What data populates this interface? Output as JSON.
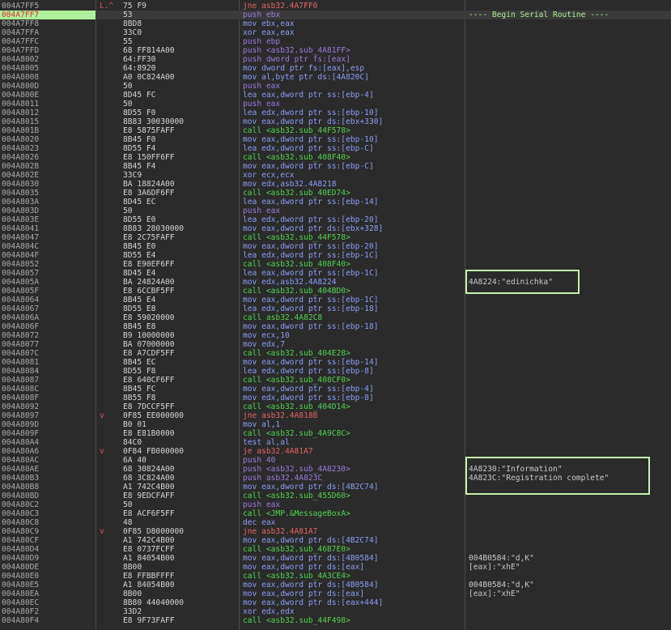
{
  "colors": {
    "background": "#2b2b2b",
    "selected_row": "#aef09a",
    "call": "#52d152",
    "jump": "#e06666",
    "push": "#9b7bd9",
    "mov": "#8c9ef2",
    "highlight_box": "#c8f0b0"
  },
  "rows": [
    {
      "addr": "004A7FF5",
      "mark": "L.^",
      "bytes": "75 F9",
      "instr": "jne asb32.4A7FF0",
      "kind": "jmp",
      "comment": ""
    },
    {
      "addr": "004A7FF7",
      "mark": "",
      "bytes": "53",
      "instr": "push ebx",
      "kind": "push",
      "comment": "---- Begin Serial Routine ----",
      "selected": true
    },
    {
      "addr": "004A7FF8",
      "mark": "",
      "bytes": "8BD8",
      "instr": "mov ebx,eax",
      "kind": "mov",
      "comment": ""
    },
    {
      "addr": "004A7FFA",
      "mark": "",
      "bytes": "33C0",
      "instr": "xor eax,eax",
      "kind": "xor",
      "comment": ""
    },
    {
      "addr": "004A7FFC",
      "mark": "",
      "bytes": "55",
      "instr": "push ebp",
      "kind": "push",
      "comment": ""
    },
    {
      "addr": "004A7FFD",
      "mark": "",
      "bytes": "68 FF814A00",
      "instr": "push <asb32.sub_4A81FF>",
      "kind": "push",
      "comment": ""
    },
    {
      "addr": "004A8002",
      "mark": "",
      "bytes": "64:FF30",
      "instr": "push dword ptr fs:[eax]",
      "kind": "push",
      "comment": ""
    },
    {
      "addr": "004A8005",
      "mark": "",
      "bytes": "64:8920",
      "instr": "mov dword ptr fs:[eax],esp",
      "kind": "mov",
      "comment": ""
    },
    {
      "addr": "004A8008",
      "mark": "",
      "bytes": "A0 0C824A00",
      "instr": "mov al,byte ptr ds:[4A820C]",
      "kind": "mov",
      "comment": ""
    },
    {
      "addr": "004A800D",
      "mark": "",
      "bytes": "50",
      "instr": "push eax",
      "kind": "push",
      "comment": ""
    },
    {
      "addr": "004A800E",
      "mark": "",
      "bytes": "8D45 FC",
      "instr": "lea eax,dword ptr ss:[ebp-4]",
      "kind": "lea",
      "comment": ""
    },
    {
      "addr": "004A8011",
      "mark": "",
      "bytes": "50",
      "instr": "push eax",
      "kind": "push",
      "comment": ""
    },
    {
      "addr": "004A8012",
      "mark": "",
      "bytes": "8D55 F0",
      "instr": "lea edx,dword ptr ss:[ebp-10]",
      "kind": "lea",
      "comment": ""
    },
    {
      "addr": "004A8015",
      "mark": "",
      "bytes": "8B83 30030000",
      "instr": "mov eax,dword ptr ds:[ebx+330]",
      "kind": "mov",
      "comment": ""
    },
    {
      "addr": "004A801B",
      "mark": "",
      "bytes": "E8 5875FAFF",
      "instr": "call <asb32.sub_44F578>",
      "kind": "call",
      "comment": ""
    },
    {
      "addr": "004A8020",
      "mark": "",
      "bytes": "8B45 F0",
      "instr": "mov eax,dword ptr ss:[ebp-10]",
      "kind": "mov",
      "comment": ""
    },
    {
      "addr": "004A8023",
      "mark": "",
      "bytes": "8D55 F4",
      "instr": "lea edx,dword ptr ss:[ebp-C]",
      "kind": "lea",
      "comment": ""
    },
    {
      "addr": "004A8026",
      "mark": "",
      "bytes": "E8 150FF6FF",
      "instr": "call <asb32.sub_408F40>",
      "kind": "call",
      "comment": ""
    },
    {
      "addr": "004A802B",
      "mark": "",
      "bytes": "8B45 F4",
      "instr": "mov eax,dword ptr ss:[ebp-C]",
      "kind": "mov",
      "comment": ""
    },
    {
      "addr": "004A802E",
      "mark": "",
      "bytes": "33C9",
      "instr": "xor ecx,ecx",
      "kind": "xor",
      "comment": ""
    },
    {
      "addr": "004A8030",
      "mark": "",
      "bytes": "BA 18824A00",
      "instr": "mov edx,asb32.4A8218",
      "kind": "mov",
      "comment": ""
    },
    {
      "addr": "004A8035",
      "mark": "",
      "bytes": "E8 3A6DF6FF",
      "instr": "call <asb32.sub_40ED74>",
      "kind": "call",
      "comment": ""
    },
    {
      "addr": "004A803A",
      "mark": "",
      "bytes": "8D45 EC",
      "instr": "lea eax,dword ptr ss:[ebp-14]",
      "kind": "lea",
      "comment": ""
    },
    {
      "addr": "004A803D",
      "mark": "",
      "bytes": "50",
      "instr": "push eax",
      "kind": "push",
      "comment": ""
    },
    {
      "addr": "004A803E",
      "mark": "",
      "bytes": "8D55 E0",
      "instr": "lea edx,dword ptr ss:[ebp-20]",
      "kind": "lea",
      "comment": ""
    },
    {
      "addr": "004A8041",
      "mark": "",
      "bytes": "8B83 28030000",
      "instr": "mov eax,dword ptr ds:[ebx+328]",
      "kind": "mov",
      "comment": ""
    },
    {
      "addr": "004A8047",
      "mark": "",
      "bytes": "E8 2C75FAFF",
      "instr": "call <asb32.sub_44F578>",
      "kind": "call",
      "comment": ""
    },
    {
      "addr": "004A804C",
      "mark": "",
      "bytes": "8B45 E0",
      "instr": "mov eax,dword ptr ss:[ebp-20]",
      "kind": "mov",
      "comment": ""
    },
    {
      "addr": "004A804F",
      "mark": "",
      "bytes": "8D55 E4",
      "instr": "lea edx,dword ptr ss:[ebp-1C]",
      "kind": "lea",
      "comment": ""
    },
    {
      "addr": "004A8052",
      "mark": "",
      "bytes": "E8 E90EF6FF",
      "instr": "call <asb32.sub_408F40>",
      "kind": "call",
      "comment": ""
    },
    {
      "addr": "004A8057",
      "mark": "",
      "bytes": "8D45 E4",
      "instr": "lea eax,dword ptr ss:[ebp-1C]",
      "kind": "lea",
      "comment": ""
    },
    {
      "addr": "004A805A",
      "mark": "",
      "bytes": "BA 24824A00",
      "instr": "mov edx,asb32.4A8224",
      "kind": "mov",
      "comment": "4A8224:\"edinichka\""
    },
    {
      "addr": "004A805F",
      "mark": "",
      "bytes": "E8 6CCBF5FF",
      "instr": "call <asb32.sub_404BD0>",
      "kind": "call",
      "comment": ""
    },
    {
      "addr": "004A8064",
      "mark": "",
      "bytes": "8B45 E4",
      "instr": "mov eax,dword ptr ss:[ebp-1C]",
      "kind": "mov",
      "comment": ""
    },
    {
      "addr": "004A8067",
      "mark": "",
      "bytes": "8D55 E8",
      "instr": "lea edx,dword ptr ss:[ebp-18]",
      "kind": "lea",
      "comment": ""
    },
    {
      "addr": "004A806A",
      "mark": "",
      "bytes": "E8 59020000",
      "instr": "call asb32.4A82C8",
      "kind": "call",
      "comment": ""
    },
    {
      "addr": "004A806F",
      "mark": "",
      "bytes": "8B45 E8",
      "instr": "mov eax,dword ptr ss:[ebp-18]",
      "kind": "mov",
      "comment": ""
    },
    {
      "addr": "004A8072",
      "mark": "",
      "bytes": "B9 10000000",
      "instr": "mov ecx,10",
      "kind": "mov",
      "comment": ""
    },
    {
      "addr": "004A8077",
      "mark": "",
      "bytes": "BA 07000000",
      "instr": "mov edx,7",
      "kind": "mov",
      "comment": ""
    },
    {
      "addr": "004A807C",
      "mark": "",
      "bytes": "E8 A7CDF5FF",
      "instr": "call <asb32.sub_404E28>",
      "kind": "call",
      "comment": ""
    },
    {
      "addr": "004A8081",
      "mark": "",
      "bytes": "8B45 EC",
      "instr": "mov eax,dword ptr ss:[ebp-14]",
      "kind": "mov",
      "comment": ""
    },
    {
      "addr": "004A8084",
      "mark": "",
      "bytes": "8D55 F8",
      "instr": "lea edx,dword ptr ss:[ebp-8]",
      "kind": "lea",
      "comment": ""
    },
    {
      "addr": "004A8087",
      "mark": "",
      "bytes": "E8 640CF6FF",
      "instr": "call <asb32.sub_408CF0>",
      "kind": "call",
      "comment": ""
    },
    {
      "addr": "004A808C",
      "mark": "",
      "bytes": "8B45 FC",
      "instr": "mov eax,dword ptr ss:[ebp-4]",
      "kind": "mov",
      "comment": ""
    },
    {
      "addr": "004A808F",
      "mark": "",
      "bytes": "8B55 F8",
      "instr": "mov edx,dword ptr ss:[ebp-8]",
      "kind": "mov",
      "comment": ""
    },
    {
      "addr": "004A8092",
      "mark": "",
      "bytes": "E8 7DCCF5FF",
      "instr": "call <asb32.sub_404D14>",
      "kind": "call",
      "comment": ""
    },
    {
      "addr": "004A8097",
      "mark": "v",
      "bytes": "0F85 EE000000",
      "instr": "jne asb32.4A818B",
      "kind": "jmp",
      "comment": ""
    },
    {
      "addr": "004A809D",
      "mark": "",
      "bytes": "B0 01",
      "instr": "mov al,1",
      "kind": "mov",
      "comment": ""
    },
    {
      "addr": "004A809F",
      "mark": "",
      "bytes": "E8 E81B0000",
      "instr": "call <asb32.sub_4A9C8C>",
      "kind": "call",
      "comment": ""
    },
    {
      "addr": "004A80A4",
      "mark": "",
      "bytes": "84C0",
      "instr": "test al,al",
      "kind": "test",
      "comment": ""
    },
    {
      "addr": "004A80A6",
      "mark": "v",
      "bytes": "0F84 FB000000",
      "instr": "je asb32.4A81A7",
      "kind": "jmp",
      "comment": ""
    },
    {
      "addr": "004A80AC",
      "mark": "",
      "bytes": "6A 40",
      "instr": "push 40",
      "kind": "push",
      "comment": ""
    },
    {
      "addr": "004A80AE",
      "mark": "",
      "bytes": "68 30824A00",
      "instr": "push <asb32.sub_4A8230>",
      "kind": "push",
      "comment": "4A8230:\"Information\""
    },
    {
      "addr": "004A80B3",
      "mark": "",
      "bytes": "68 3C824A00",
      "instr": "push asb32.4A823C",
      "kind": "push",
      "comment": "4A823C:\"Registration complete\""
    },
    {
      "addr": "004A80B8",
      "mark": "",
      "bytes": "A1 742C4B00",
      "instr": "mov eax,dword ptr ds:[4B2C74]",
      "kind": "mov",
      "comment": ""
    },
    {
      "addr": "004A80BD",
      "mark": "",
      "bytes": "E8 9EDCFAFF",
      "instr": "call <asb32.sub_455D60>",
      "kind": "call",
      "comment": ""
    },
    {
      "addr": "004A80C2",
      "mark": "",
      "bytes": "50",
      "instr": "push eax",
      "kind": "push",
      "comment": ""
    },
    {
      "addr": "004A80C3",
      "mark": "",
      "bytes": "E8 ACF6F5FF",
      "instr": "call <JMP.&MessageBoxA>",
      "kind": "call",
      "comment": ""
    },
    {
      "addr": "004A80C8",
      "mark": "",
      "bytes": "48",
      "instr": "dec eax",
      "kind": "dec",
      "comment": ""
    },
    {
      "addr": "004A80C9",
      "mark": "v",
      "bytes": "0F85 D8000000",
      "instr": "jne asb32.4A81A7",
      "kind": "jmp",
      "comment": ""
    },
    {
      "addr": "004A80CF",
      "mark": "",
      "bytes": "A1 742C4B00",
      "instr": "mov eax,dword ptr ds:[4B2C74]",
      "kind": "mov",
      "comment": ""
    },
    {
      "addr": "004A80D4",
      "mark": "",
      "bytes": "E8 0737FCFF",
      "instr": "call <asb32.sub_46B7E0>",
      "kind": "call",
      "comment": ""
    },
    {
      "addr": "004A80D9",
      "mark": "",
      "bytes": "A1 84054B00",
      "instr": "mov eax,dword ptr ds:[4B0584]",
      "kind": "mov",
      "comment": "004B0584:\"d,K\""
    },
    {
      "addr": "004A80DE",
      "mark": "",
      "bytes": "8B00",
      "instr": "mov eax,dword ptr ds:[eax]",
      "kind": "mov",
      "comment": "[eax]:\"xhE\""
    },
    {
      "addr": "004A80E0",
      "mark": "",
      "bytes": "E8 FFBBFFFF",
      "instr": "call <asb32.sub_4A3CE4>",
      "kind": "call",
      "comment": ""
    },
    {
      "addr": "004A80E5",
      "mark": "",
      "bytes": "A1 84054B00",
      "instr": "mov eax,dword ptr ds:[4B0584]",
      "kind": "mov",
      "comment": "004B0584:\"d,K\""
    },
    {
      "addr": "004A80EA",
      "mark": "",
      "bytes": "8B00",
      "instr": "mov eax,dword ptr ds:[eax]",
      "kind": "mov",
      "comment": "[eax]:\"xhE\""
    },
    {
      "addr": "004A80EC",
      "mark": "",
      "bytes": "8B80 44040000",
      "instr": "mov eax,dword ptr ds:[eax+444]",
      "kind": "mov",
      "comment": ""
    },
    {
      "addr": "004A80F2",
      "mark": "",
      "bytes": "33D2",
      "instr": "xor edx,edx",
      "kind": "xor",
      "comment": ""
    },
    {
      "addr": "004A80F4",
      "mark": "",
      "bytes": "E8 9F73FAFF",
      "instr": "call <asb32.sub_44F498>",
      "kind": "call",
      "comment": ""
    }
  ]
}
